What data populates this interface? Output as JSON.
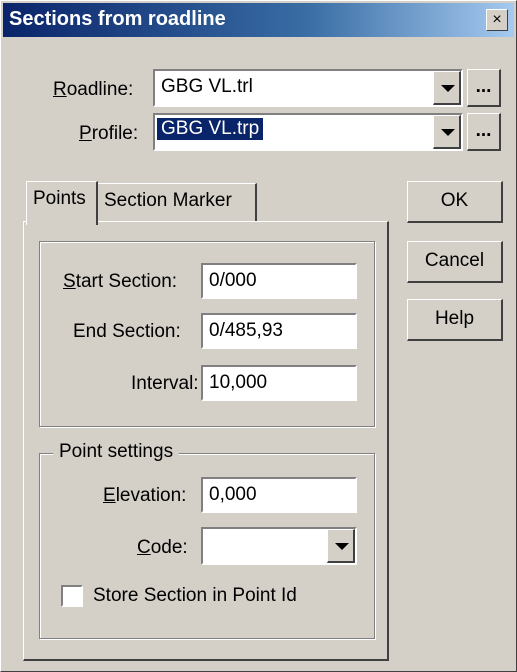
{
  "window": {
    "title": "Sections from roadline"
  },
  "roadline": {
    "label_hot": "R",
    "label_rest": "oadline:",
    "value": "GBG VL.trl",
    "browse_label": "..."
  },
  "profile": {
    "label_hot": "P",
    "label_rest": "rofile:",
    "value": "GBG VL.trp",
    "browse_label": "..."
  },
  "tabs": [
    {
      "label": "Points"
    },
    {
      "label": "Section Marker"
    }
  ],
  "sections": {
    "start": {
      "label_hot": "S",
      "label_rest": "tart Section:",
      "value": "0/000"
    },
    "end": {
      "label": "End Section:",
      "value": "0/485,93"
    },
    "interval": {
      "label": "Interval:",
      "value": "10,000"
    }
  },
  "point_settings": {
    "group_label": "Point settings",
    "elevation": {
      "label_hot": "E",
      "label_rest": "levation:",
      "value": "0,000"
    },
    "code": {
      "label_hot": "C",
      "label_rest": "ode:",
      "value": ""
    },
    "store_section": {
      "label": "Store Section in Point Id",
      "checked": false
    }
  },
  "buttons": {
    "ok": "OK",
    "cancel": "Cancel",
    "help": "Help"
  },
  "title_close_glyph": "×"
}
